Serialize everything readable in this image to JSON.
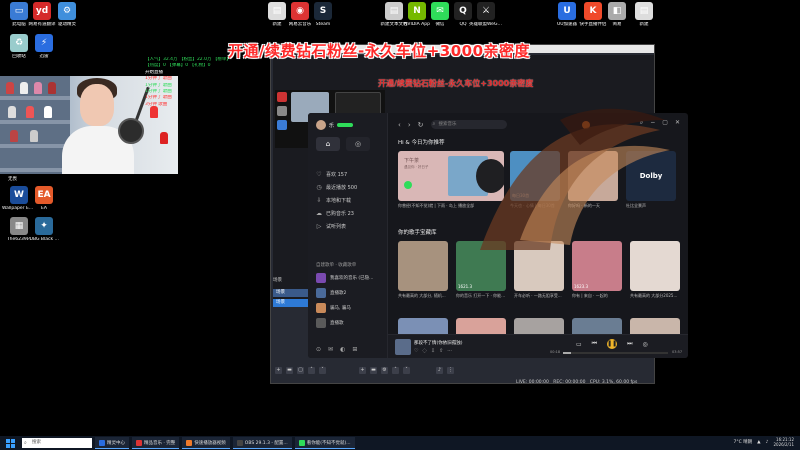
{
  "desktop": {
    "top_icons": [
      {
        "label": "此电脑",
        "color": "#3a7bd5",
        "glyph": "▭"
      },
      {
        "label": "网易有道翻译",
        "color": "#d52a2a",
        "glyph": "yd"
      },
      {
        "label": "驱动精灵",
        "color": "#3f8fdc",
        "glyph": "⚙"
      },
      {
        "label": "新建",
        "color": "#ddd",
        "glyph": "▤"
      },
      {
        "label": "网易云音乐",
        "color": "#d33",
        "glyph": "◉"
      },
      {
        "label": "Steam",
        "color": "#1b2838",
        "glyph": "S"
      },
      {
        "label": "新建文本文档",
        "color": "#ccc",
        "glyph": "▤"
      },
      {
        "label": "NVIDIA App",
        "color": "#76b900",
        "glyph": "N"
      },
      {
        "label": "微信",
        "color": "#2fdc5a",
        "glyph": "✉"
      },
      {
        "label": "QQ",
        "color": "#222",
        "glyph": "Q"
      },
      {
        "label": "英雄联盟WeGame",
        "color": "#222",
        "glyph": "⚔"
      },
      {
        "label": "UU加速器",
        "color": "#2a6de0",
        "glyph": "U"
      },
      {
        "label": "快手直播伴侣",
        "color": "#f04a2a",
        "glyph": "K"
      },
      {
        "label": "简易",
        "color": "#aaa",
        "glyph": "◧"
      },
      {
        "label": "新建",
        "color": "#ddd",
        "glyph": "▤"
      }
    ],
    "left_icons": [
      {
        "label": "回收站",
        "color": "#9cc",
        "glyph": "♻"
      },
      {
        "label": "迅雷",
        "color": "#2a6de0",
        "glyph": "⚡"
      },
      {
        "label": "Wallpaper Engine",
        "color": "#1a4c9a",
        "glyph": "W"
      },
      {
        "label": "EA",
        "color": "#e45a2a",
        "glyph": "EA"
      },
      {
        "label": "The6239...",
        "color": "#888",
        "glyph": "▦"
      },
      {
        "label": "PUBG Black Budget Pl...",
        "color": "#2a6a9a",
        "glyph": "✦"
      },
      {
        "label": "无畏",
        "color": "#333",
        "glyph": "◆"
      }
    ]
  },
  "banner": {
    "main": "开通/续费钻石粉丝-永久车位+3000亲密度",
    "echo": "开通/续费钻石粉丝-永久车位+3000亲密度"
  },
  "chat": {
    "lines": [
      {
        "cls": "g",
        "text": "【人气】32.4万 【粉丝】22.0万 【榜单】"
      },
      {
        "cls": "g",
        "text": "【热度】0 【弹幕】0 【礼物】0"
      },
      {
        "cls": "w",
        "text": "开始直播"
      },
      {
        "cls": "r",
        "text": "1分钟了 歌曲"
      },
      {
        "cls": "g",
        "text": "1分钟了 歌曲"
      },
      {
        "cls": "g",
        "text": "1分钟了 歌曲"
      },
      {
        "cls": "r",
        "text": "1分钟了 歌曲"
      },
      {
        "cls": "r",
        "text": "3分钟 歌曲"
      }
    ]
  },
  "obs": {
    "scenes_header": "场景",
    "scenes": [
      "场景",
      "场景"
    ],
    "status": {
      "live": "LIVE: 00:00:00",
      "rec": "REC: 00:00:00",
      "cpu": "CPU: 3.1%, 60.00 fps"
    }
  },
  "music": {
    "user": {
      "name": "乐"
    },
    "tabs": [
      "⌂",
      "◎"
    ],
    "menu": [
      {
        "icon": "♡",
        "label": "喜欢 157"
      },
      {
        "icon": "◷",
        "label": "最近播放 500"
      },
      {
        "icon": "⇩",
        "label": "本地和下载"
      },
      {
        "icon": "☁",
        "label": "已购音乐 23"
      },
      {
        "icon": "▷",
        "label": "试听列表"
      }
    ],
    "section": "自建歌单 · 收藏歌单",
    "playlists": [
      {
        "label": "我喜欢的音乐 (已隐...",
        "color": "#7a4ab0"
      },
      {
        "label": "直播歌2",
        "color": "#4a6a9a"
      },
      {
        "label": "骗马, 骗马",
        "color": "#c98a5a"
      },
      {
        "label": "直播歌",
        "color": "#5a5a5a"
      }
    ],
    "search_placeholder": "搜索音乐",
    "nav": [
      "‹",
      "›",
      "↻"
    ],
    "heading_daily": "Hi & 今日为你推荐",
    "heading_fav": "你的歌手宝藏库",
    "daily_big": {
      "title": "下午茶",
      "sub": "遇见你 · 好日子"
    },
    "daily_cards": [
      {
        "caption": "你曾经(不知不觉)就 | 下雨 · 岛上 播放全部",
        "color": "#d9b7b6",
        "overlay": ""
      },
      {
        "caption": "今天也 · 心情 | 每日30首",
        "color": "#4d8fc2",
        "overlay": "每日30首"
      },
      {
        "caption": "你好吗 · 新的一天",
        "color": "#c7a99a",
        "overlay": ""
      },
      {
        "caption": "杜比全景声",
        "color": "#1d2a3f",
        "overlay": "Dolby"
      }
    ],
    "fav_cards": [
      {
        "caption": "共有最高的 大部分, 随机...",
        "color": "#a7927e",
        "overlay": ""
      },
      {
        "caption": "你的音乐 打开一下 · 你能在听...",
        "color": "#3f7a52",
        "overlay": "1621.3"
      },
      {
        "caption": "开车必听 · 一路无阻享受...",
        "color": "#d8c9be",
        "overlay": ""
      },
      {
        "caption": "你有 | 来自 · 一起的",
        "color": "#c87d8a",
        "overlay": "1623.3"
      },
      {
        "caption": "共有最高的 大部分2025...",
        "color": "#e4d9d2",
        "overlay": ""
      }
    ],
    "row3_colors": [
      "#7b90b5",
      "#d9a29a",
      "#a7a2a0",
      "#6a7d93",
      "#c9b6aa"
    ],
    "player": {
      "title": "那段不了情(你依旧孤独)",
      "time_current": "00:18",
      "time_total": "03:57",
      "progress_pct": 8,
      "quality": "HQ"
    }
  },
  "taskbar": {
    "search_placeholder": "搜索",
    "buttons": [
      {
        "label": "精灵中心",
        "color": "#2a6de0"
      },
      {
        "label": "精品音乐 · 完整",
        "color": "#d33"
      },
      {
        "label": "快速播放器视频",
        "color": "#f07a2a"
      },
      {
        "label": "OBS 29.1.3 - 配置...",
        "color": "#444"
      },
      {
        "label": "看你能(不知不觉就)...",
        "color": "#2fdc5a"
      }
    ],
    "weather": "7°C 晴朗",
    "time": "16:21:12",
    "date": "2026/2/11"
  }
}
